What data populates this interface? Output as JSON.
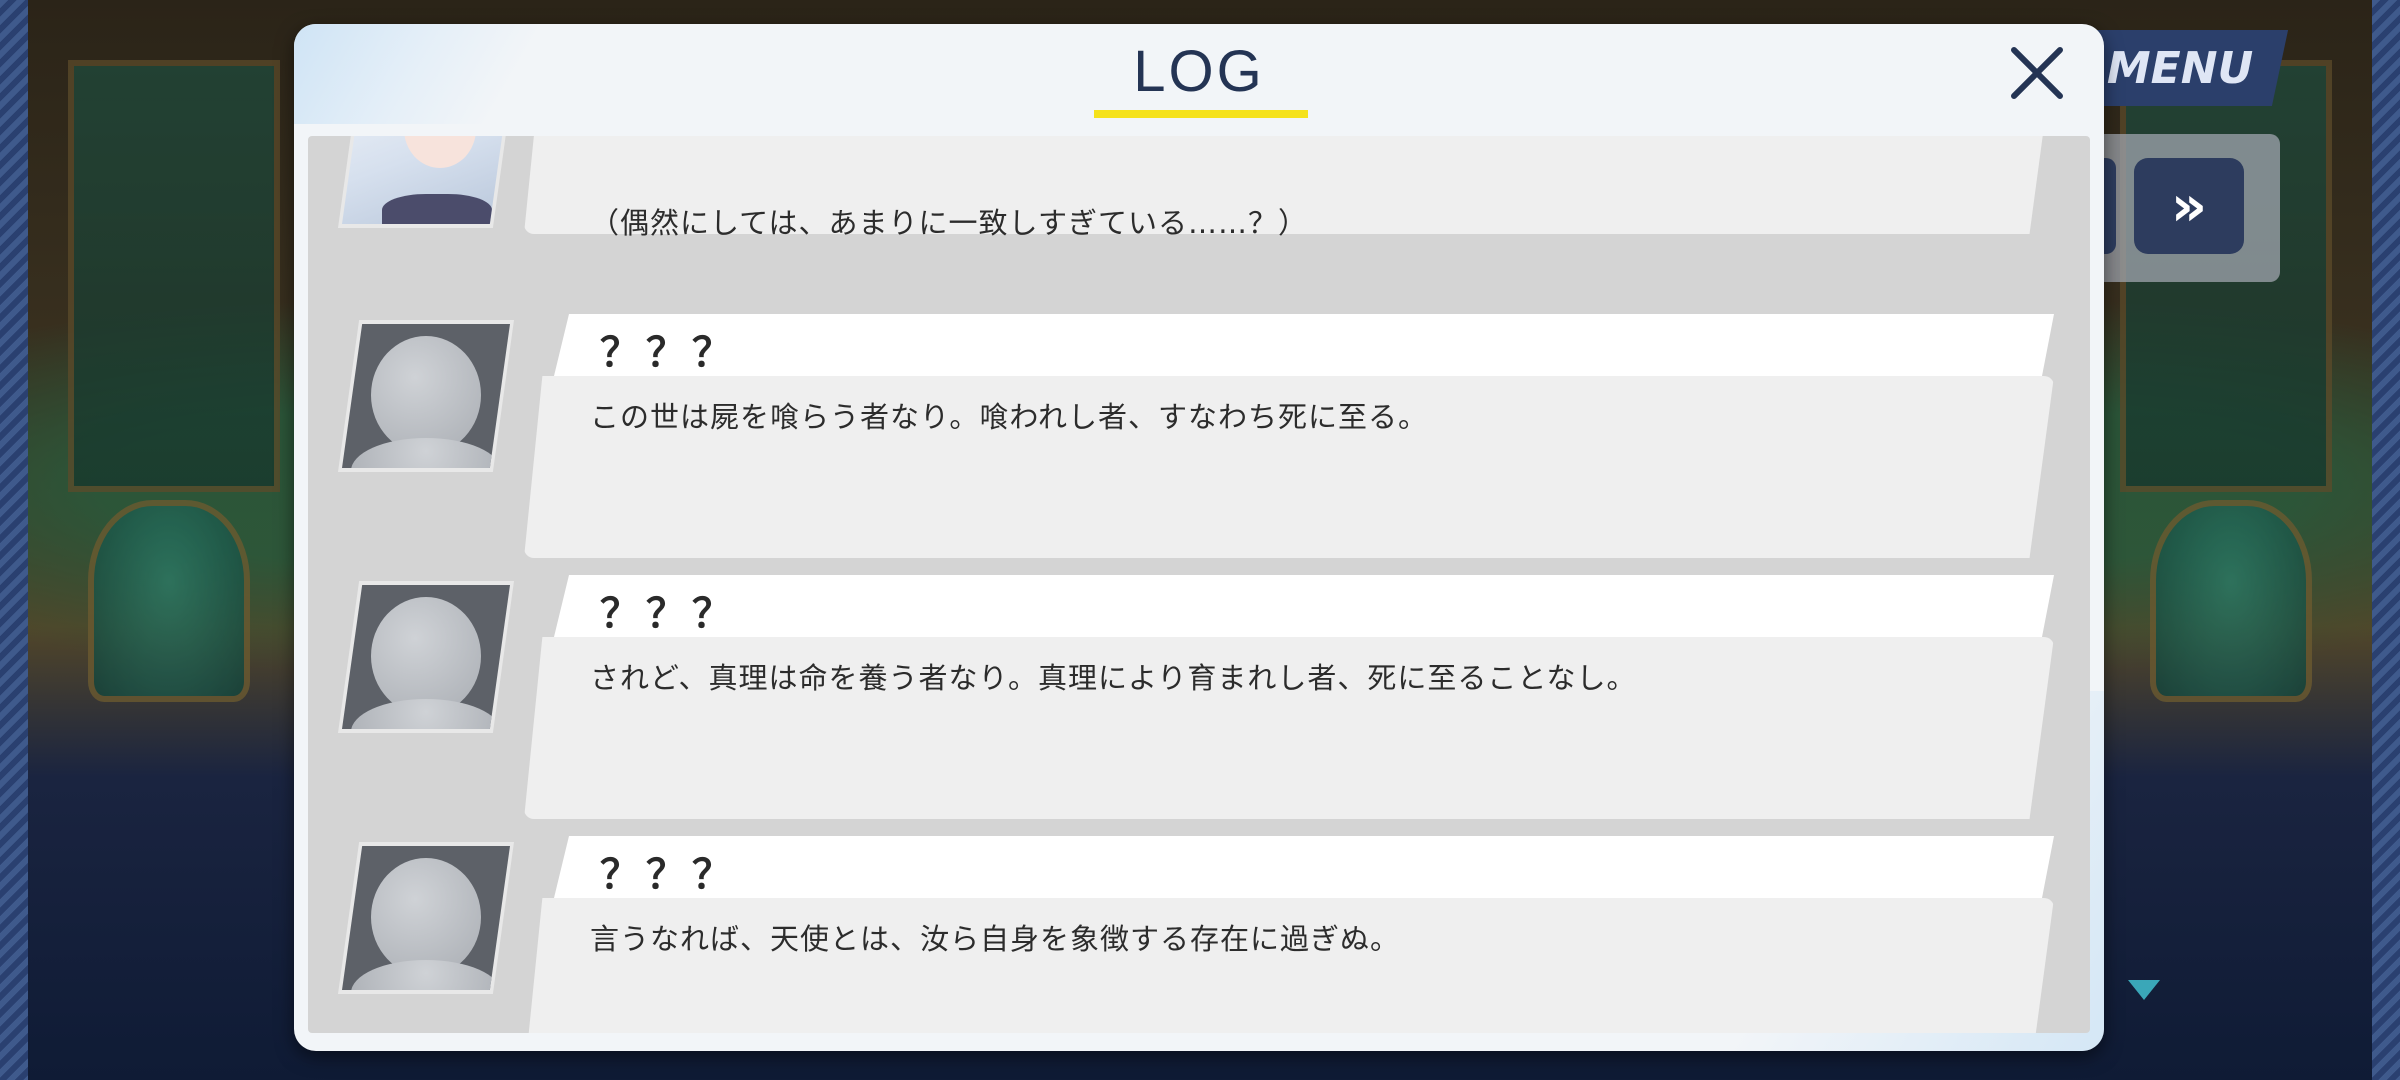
{
  "header": {
    "menu_label": "MENU",
    "skip_glyph": "»"
  },
  "log": {
    "title": "LOG",
    "entries": [
      {
        "speaker": "",
        "avatar": "character-portrait",
        "text": "（偶然にしては、あまりに一致しすぎている……？）"
      },
      {
        "speaker": "？？？",
        "avatar": "unknown-silhouette",
        "text": "この世は屍を喰らう者なり。喰われし者、すなわち死に至る。"
      },
      {
        "speaker": "？？？",
        "avatar": "unknown-silhouette",
        "text": "されど、真理は命を養う者なり。真理により育まれし者、死に至ることなし。"
      },
      {
        "speaker": "？？？",
        "avatar": "unknown-silhouette",
        "text": "言うなれば、天使とは、汝ら自身を象徴する存在に過ぎぬ。"
      }
    ]
  },
  "colors": {
    "title": "#243454",
    "underline": "#f5e21c",
    "panel": "#d4d4d4"
  }
}
